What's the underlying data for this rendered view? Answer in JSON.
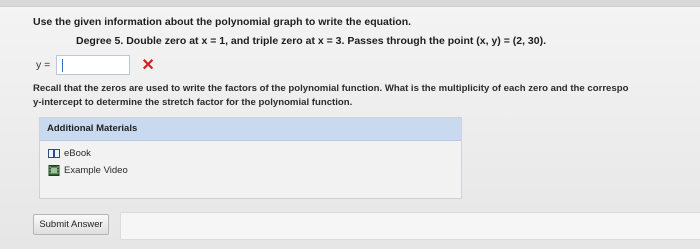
{
  "question": {
    "instruction": "Use the given information about the polynomial graph to write the equation.",
    "problem": "Degree 5. Double zero at x = 1, and triple zero at x = 3. Passes through the point (x, y) = (2, 30).",
    "answer_label": "y =",
    "answer_value": "",
    "result_mark": "✕",
    "hint_line1": "Recall that the zeros are used to write the factors of the polynomial function. What is the multiplicity of each zero and the correspo",
    "hint_line2": "y-intercept to determine the stretch factor for the polynomial function."
  },
  "materials": {
    "header": "Additional Materials",
    "items": [
      {
        "label": "eBook",
        "icon": "book-icon"
      },
      {
        "label": "Example Video",
        "icon": "film-icon"
      }
    ]
  },
  "actions": {
    "submit_label": "Submit Answer"
  },
  "colors": {
    "materials_header_bg": "#c9daf0",
    "error_mark": "#d32020"
  }
}
